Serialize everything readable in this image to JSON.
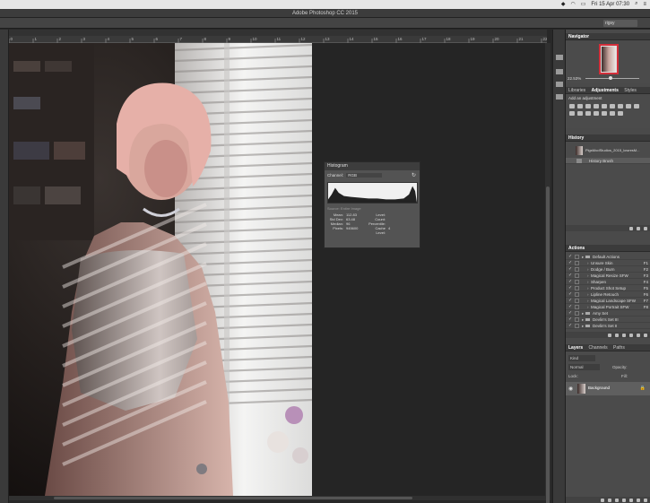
{
  "menubar": {
    "date_time": "Fri 15 Apr  07:30",
    "icons": [
      "dropbox-icon",
      "wifi-icon",
      "battery-icon",
      "search-icon",
      "menu-icon"
    ]
  },
  "window": {
    "title": "Adobe Photoshop CC 2015",
    "workspace": "rigsy"
  },
  "ruler": {
    "ticks": [
      "0",
      "1",
      "2",
      "3",
      "4",
      "5",
      "6",
      "7",
      "8",
      "9",
      "10",
      "11",
      "12",
      "13",
      "14",
      "15",
      "16",
      "17",
      "18",
      "19",
      "20",
      "21",
      "22"
    ]
  },
  "histogram": {
    "title": "Histogram",
    "channel_label": "Channel:",
    "channel_value": "RGB",
    "source_label": "Source:",
    "source_value": "Entire Image",
    "stats": [
      {
        "l1": "Mean:",
        "v1": "112.83",
        "l2": "Level:",
        "v2": ""
      },
      {
        "l1": "Std Dev:",
        "v1": "63.48",
        "l2": "Count:",
        "v2": ""
      },
      {
        "l1": "Median:",
        "v1": "96",
        "l2": "Percentile:",
        "v2": ""
      },
      {
        "l1": "Pixels:",
        "v1": "945600",
        "l2": "Cache Level:",
        "v2": "4"
      }
    ]
  },
  "navigator": {
    "title": "Navigator",
    "zoom": "22.53%"
  },
  "adjustments": {
    "tabs": [
      "Libraries",
      "Adjustments",
      "Styles"
    ],
    "active_tab": "Adjustments",
    "hint": "Add an adjustment"
  },
  "history": {
    "title": "History",
    "snapshot": "PigsModStudios_2015_lowresM...",
    "items": [
      "History Brush"
    ]
  },
  "actions": {
    "title": "Actions",
    "rows": [
      {
        "label": "Default Actions",
        "key": "",
        "indent": 0,
        "folder": true
      },
      {
        "label": "Unsure Skin",
        "key": "F1",
        "indent": 1
      },
      {
        "label": "Dodge / Burn",
        "key": "F2",
        "indent": 1
      },
      {
        "label": "Magical Resize SFW",
        "key": "F3",
        "indent": 1
      },
      {
        "label": "Sharpen",
        "key": "F4",
        "indent": 1
      },
      {
        "label": "Product Shot Setup",
        "key": "F5",
        "indent": 1
      },
      {
        "label": "Lipline Retouch",
        "key": "F6",
        "indent": 1
      },
      {
        "label": "Magical Landscape SFW",
        "key": "F7",
        "indent": 1
      },
      {
        "label": "Magical Portrait SFW",
        "key": "F8",
        "indent": 1
      },
      {
        "label": "Amy Set",
        "key": "",
        "indent": 0,
        "folder": true
      },
      {
        "label": "Devlin's Set III",
        "key": "",
        "indent": 0,
        "folder": true
      },
      {
        "label": "Devlin's Set II",
        "key": "",
        "indent": 0,
        "folder": true
      }
    ]
  },
  "layers": {
    "tabs": [
      "Layers",
      "Channels",
      "Paths"
    ],
    "active_tab": "Layers",
    "kind_label": "Kind",
    "blend_mode": "Normal",
    "opacity_label": "Opacity:",
    "lock_label": "Lock:",
    "fill_label": "Fill:",
    "layer_name": "Background"
  }
}
